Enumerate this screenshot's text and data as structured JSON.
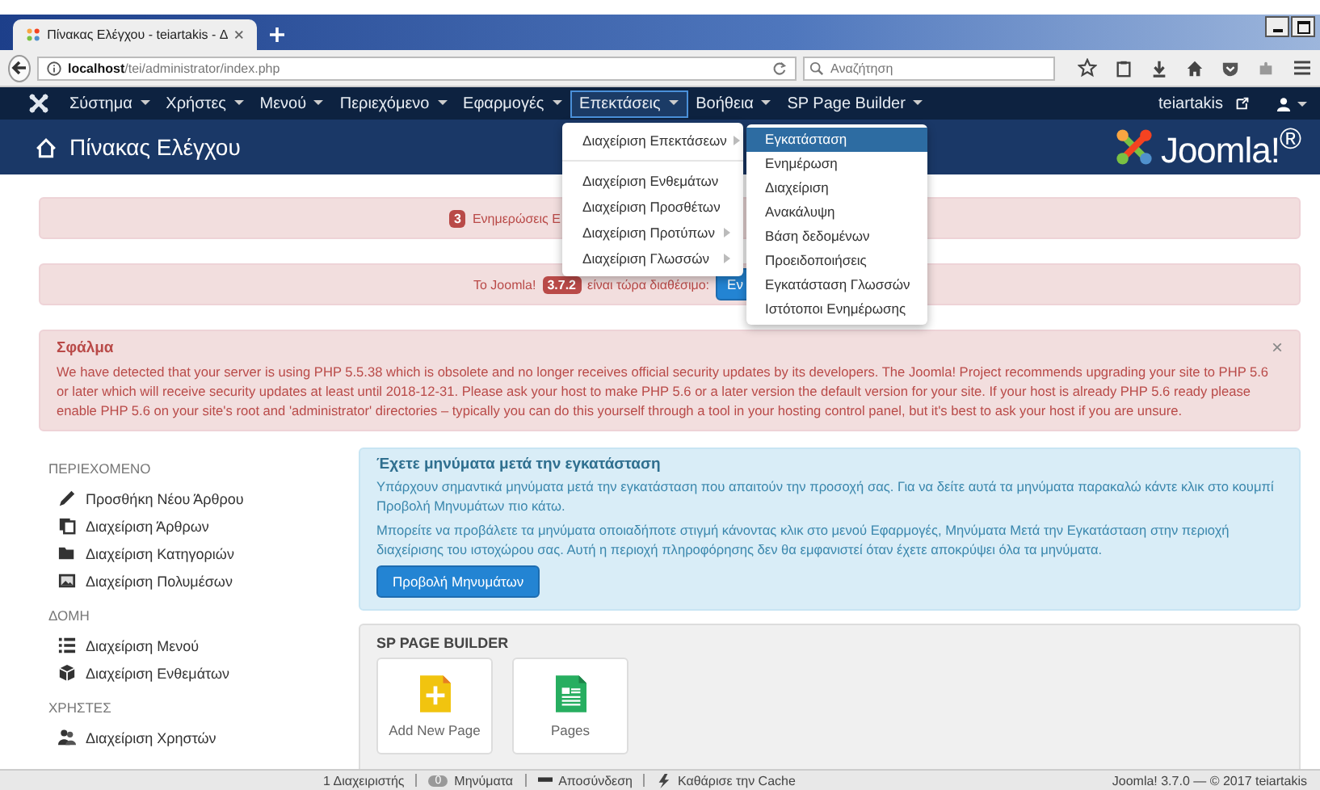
{
  "browser": {
    "tab_title": "Πίνακας Ελέγχου - teiartakis - Δ",
    "url_host": "localhost",
    "url_path": "/tei/administrator/index.php",
    "search": {
      "placeholder": "Αναζήτηση"
    }
  },
  "nav": {
    "items": [
      {
        "label": "Σύστημα",
        "selected": false
      },
      {
        "label": "Χρήστες",
        "selected": false
      },
      {
        "label": "Μενού",
        "selected": false
      },
      {
        "label": "Περιεχόμενο",
        "selected": false
      },
      {
        "label": "Εφαρμογές",
        "selected": false
      },
      {
        "label": "Επεκτάσεις",
        "selected": true
      },
      {
        "label": "Βοήθεια",
        "selected": false
      },
      {
        "label": "SP Page Builder",
        "selected": false
      }
    ],
    "user": "teiartakis",
    "dropdown": [
      {
        "label": "Διαχείριση Επεκτάσεων",
        "kind": "submenu"
      },
      {
        "kind": "divider"
      },
      {
        "label": "Διαχείριση Ενθεμάτων",
        "kind": "plain"
      },
      {
        "label": "Διαχείριση Προσθέτων",
        "kind": "plain"
      },
      {
        "label": "Διαχείριση Προτύπων",
        "kind": "submenu"
      },
      {
        "label": "Διαχείριση Γλωσσών",
        "kind": "submenu"
      }
    ],
    "submenu": [
      {
        "label": "Εγκατάσταση",
        "selected": true
      },
      {
        "label": "Ενημέρωση",
        "selected": false
      },
      {
        "label": "Διαχείριση",
        "selected": false
      },
      {
        "label": "Ανακάλυψη",
        "selected": false
      },
      {
        "label": "Βάση δεδομένων",
        "selected": false
      },
      {
        "label": "Προειδοποιήσεις",
        "selected": false
      },
      {
        "label": "Εγκατάσταση Γλωσσών",
        "selected": false
      },
      {
        "label": "Ιστότοποι Ενημέρωσης",
        "selected": false
      }
    ]
  },
  "header": {
    "title": "Πίνακας Ελέγχου",
    "logo": "Joomla!$^{®}$"
  },
  "alerts": [
    {
      "badge": "3",
      "text": "Ενημερώσεις Ε"
    },
    {
      "before": "Το Joomla!",
      "badge": "3.7.2",
      "after": "είναι τώρα διαθέσιμο:",
      "button": "Εν"
    }
  ],
  "error": {
    "title": "Σφάλμα",
    "text": "We have detected that your server is using PHP 5.5.38 which is obsolete and no longer receives official security updates by its developers. The Joomla! Project recommends upgrading your site to PHP 5.6 or later which will receive security updates at least until 2018-12-31. Please ask your host to make PHP 5.6 or a later version the default version for your site. If your host is already PHP 5.6 ready please enable PHP 5.6 on your site's root and 'administrator' directories – typically you can do this yourself through a tool in your hosting control panel, but it's best to ask your host if you are unsure.",
    "close": "×"
  },
  "sidebar": [
    {
      "heading": "ΠΕΡΙΕΧΟΜΕΝΟ",
      "items": [
        {
          "label": "Προσθήκη Νέου Άρθρου",
          "kind": "pencil"
        },
        {
          "label": "Διαχείριση Άρθρων",
          "kind": "copy"
        },
        {
          "label": "Διαχείριση Κατηγοριών",
          "kind": "folder"
        },
        {
          "label": "Διαχείριση Πολυμέσων",
          "kind": "image"
        }
      ]
    },
    {
      "heading": "ΔΟΜΗ",
      "items": [
        {
          "label": "Διαχείριση Μενού",
          "kind": "list"
        },
        {
          "label": "Διαχείριση Ενθεμάτων",
          "kind": "cube"
        }
      ]
    },
    {
      "heading": "ΧΡΗΣΤΕΣ",
      "items": [
        {
          "label": "Διαχείριση Χρηστών",
          "kind": "users"
        }
      ]
    }
  ],
  "postinstall": {
    "title": "Έχετε μηνύματα μετά την εγκατάσταση",
    "paragraphs": [
      "Υπάρχουν σημαντικά μηνύματα μετά την εγκατάσταση που απαιτούν την προσοχή σας. Για να δείτε αυτά τα μηνύματα παρακαλώ κάντε κλικ στο κουμπί Προβολή Μηνυμάτων πιο κάτω.",
      "Μπορείτε να προβάλετε τα μηνύματα οποιαδήποτε στιγμή κάνοντας κλικ στο μενού Εφαρμογές, Μηνύματα Μετά την Εγκατάσταση στην περιοχή διαχείρισης του ιστοχώρου σας. Αυτή η περιοχή πληροφόρησης δεν θα εμφανιστεί όταν έχετε αποκρύψει όλα τα μηνύματα."
    ],
    "button": "Προβολή Μηνυμάτων"
  },
  "sp_page_builder": {
    "title": "SP PAGE BUILDER",
    "tiles": [
      {
        "label": "Add New Page",
        "kind": "add"
      },
      {
        "label": "Pages",
        "kind": "pages"
      }
    ]
  },
  "status_bar": {
    "admins": "1 Διαχειριστής",
    "messages_count": "0",
    "messages": "Μηνύματα",
    "logout": "Αποσύνδεση",
    "cache": "Καθάρισε την Cache",
    "version": "Joomla! 3.7.0 — © 2017 teiartakis"
  }
}
